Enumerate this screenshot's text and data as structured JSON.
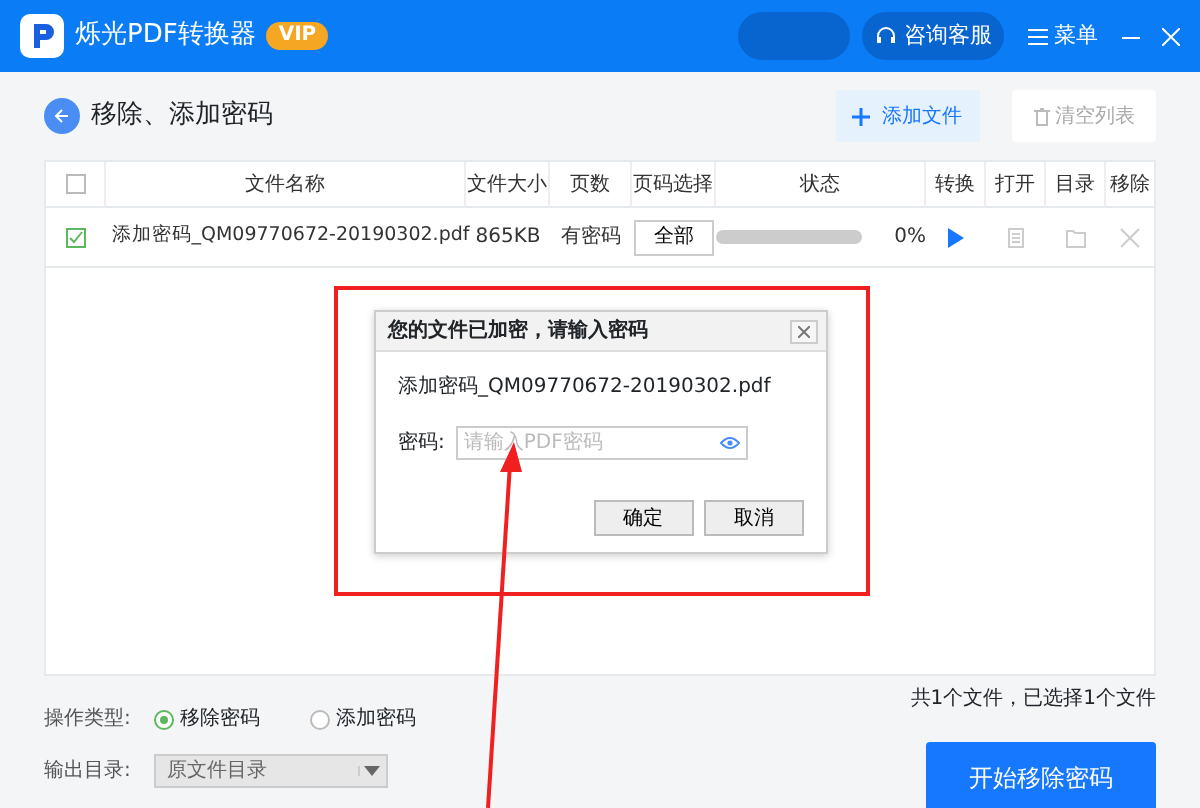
{
  "app": {
    "title": "烁光PDF转换器",
    "badge": "VIP",
    "support": "咨询客服",
    "menu": "菜单"
  },
  "page": {
    "title": "移除、添加密码",
    "add_button": "添加文件",
    "clear_button": {
      "label": "清空列表",
      "disabled": true
    }
  },
  "table": {
    "select_all": false,
    "columns": [
      "文件名称",
      "文件大小",
      "页数",
      "页码选择",
      "状态",
      "转换",
      "打开",
      "目录",
      "移除"
    ],
    "rows": [
      {
        "checked": true,
        "name": "添加密码_QM09770672-20190302.pdf",
        "size": "865KB",
        "pages": "有密码",
        "range": "全部",
        "level": 0,
        "percent": "0%"
      }
    ]
  },
  "dialog": {
    "title": "您的文件已加密，请输入密码",
    "file_name": "添加密码_QM09770672-20190302.pdf",
    "password_label": "密码:",
    "placeholder": "请输入PDF密码",
    "buttons": [
      "确定",
      "取消"
    ]
  },
  "footer": {
    "count": "共1个文件，已选择1个文件",
    "operation_label": "操作类型:",
    "options": [
      {
        "label": "移除密码",
        "selected": true
      },
      {
        "label": "添加密码",
        "selected": false
      }
    ],
    "output_label": "输出目录:",
    "output_value": "原文件目录",
    "start_button": "开始移除密码"
  }
}
